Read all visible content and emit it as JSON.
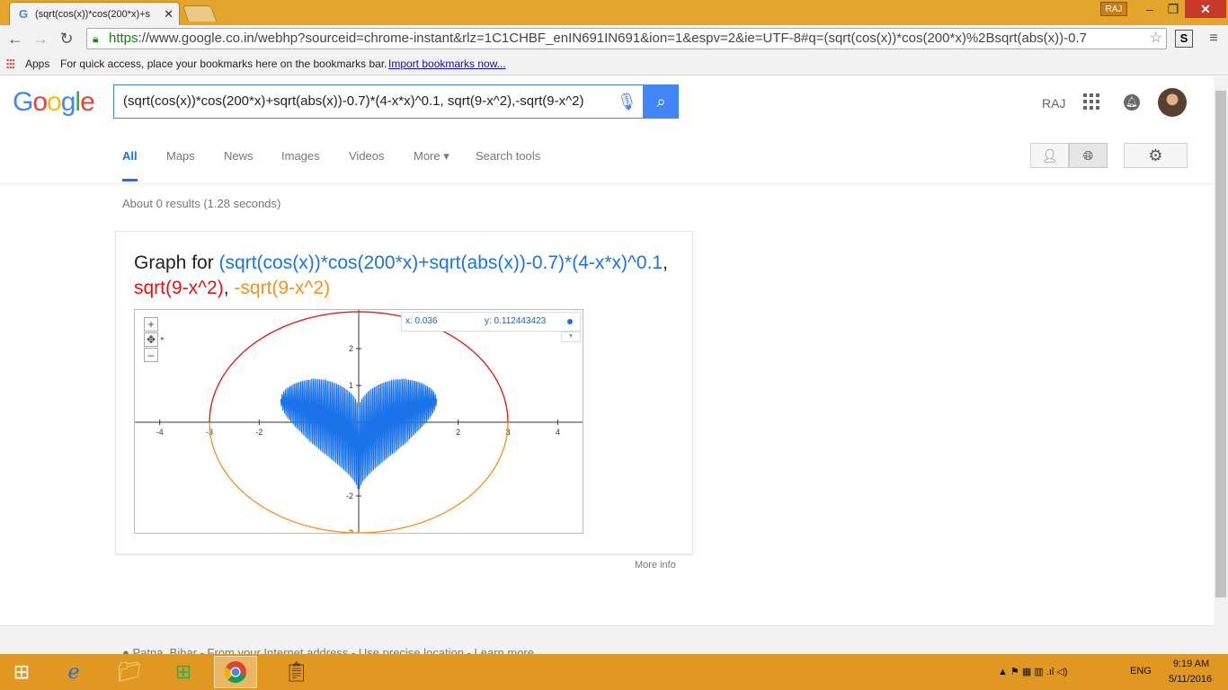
{
  "browser": {
    "tab_title": "(sqrt(cos(x))*cos(200*x)+s",
    "user_badge": "RAJ",
    "url_https": "https",
    "url_rest": "://www.google.co.in/webhp?sourceid=chrome-instant&rlz=1C1CHBF_enIN691IN691&ion=1&espv=2&ie=UTF-8#q=(sqrt(cos(x))*cos(200*x)%2Bsqrt(abs(x))-0.7",
    "bookmarks": {
      "apps": "Apps",
      "hint": "For quick access, place your bookmarks here on the bookmarks bar.",
      "import": "Import bookmarks now..."
    }
  },
  "google": {
    "logo_letters": [
      {
        "ch": "G",
        "color": "#4285f4"
      },
      {
        "ch": "o",
        "color": "#ea4335"
      },
      {
        "ch": "o",
        "color": "#fbbc05"
      },
      {
        "ch": "g",
        "color": "#4285f4"
      },
      {
        "ch": "l",
        "color": "#34a853"
      },
      {
        "ch": "e",
        "color": "#ea4335"
      }
    ],
    "query": "(sqrt(cos(x))*cos(200*x)+sqrt(abs(x))-0.7)*(4-x*x)^0.1, sqrt(9-x^2),-sqrt(9-x^2)",
    "user": "RAJ",
    "nav": {
      "all": "All",
      "maps": "Maps",
      "news": "News",
      "images": "Images",
      "videos": "Videos",
      "more": "More ▾",
      "tools": "Search tools"
    },
    "stats": "About 0 results (1.28 seconds)",
    "card": {
      "title_prefix": "Graph for ",
      "f1": "(sqrt(cos(x))*cos(200*x)+sqrt(abs(x))-0.7)*(4-x*x)^0.1",
      "f2": "sqrt(9-x^2)",
      "f3": "-sqrt(9-x^2)",
      "sep": ", ",
      "readout_x": "x: 0.036",
      "readout_y": "y: 0.112443423",
      "more_info": "More info"
    },
    "footer": "● Patna, Bihar - From your Internet address - Use precise location - Learn more"
  },
  "colors": {
    "f1": "#1a73e8",
    "f2": "#e8110f",
    "f3": "#f5901e"
  },
  "chart_data": {
    "type": "line",
    "title": "",
    "xlabel": "",
    "ylabel": "",
    "xlim": [
      -4.5,
      4.5
    ],
    "ylim": [
      -3,
      3.05
    ],
    "x_ticks": [
      -4,
      -3,
      -2,
      2,
      3,
      4
    ],
    "y_ticks": [
      2,
      1,
      -2,
      -3
    ],
    "grid": false,
    "series": [
      {
        "name": "(sqrt(cos(x))*cos(200*x)+sqrt(abs(x))-0.7)*(4-x*x)^0.1",
        "expression": "(sqrt(cos(x))*cos(200*x)+sqrt(abs(x))-0.7)*(4-x*x)^0.1",
        "domain": [
          -1.57,
          1.57
        ],
        "color": "#1a73e8"
      },
      {
        "name": "sqrt(9-x^2)",
        "expression": "sqrt(9-x^2)",
        "domain": [
          -3,
          3
        ],
        "color": "#e8110f"
      },
      {
        "name": "-sqrt(9-x^2)",
        "expression": "-sqrt(9-x^2)",
        "domain": [
          -3,
          3
        ],
        "color": "#f5901e"
      }
    ],
    "cursor": {
      "x": 0.036,
      "y": 0.112443423
    }
  },
  "taskbar": {
    "lang": "ENG",
    "time": "9:19 AM",
    "date": "5/11/2016",
    "tray": "▲ ⚑ ▦ ▥ .ıl ◁)"
  }
}
